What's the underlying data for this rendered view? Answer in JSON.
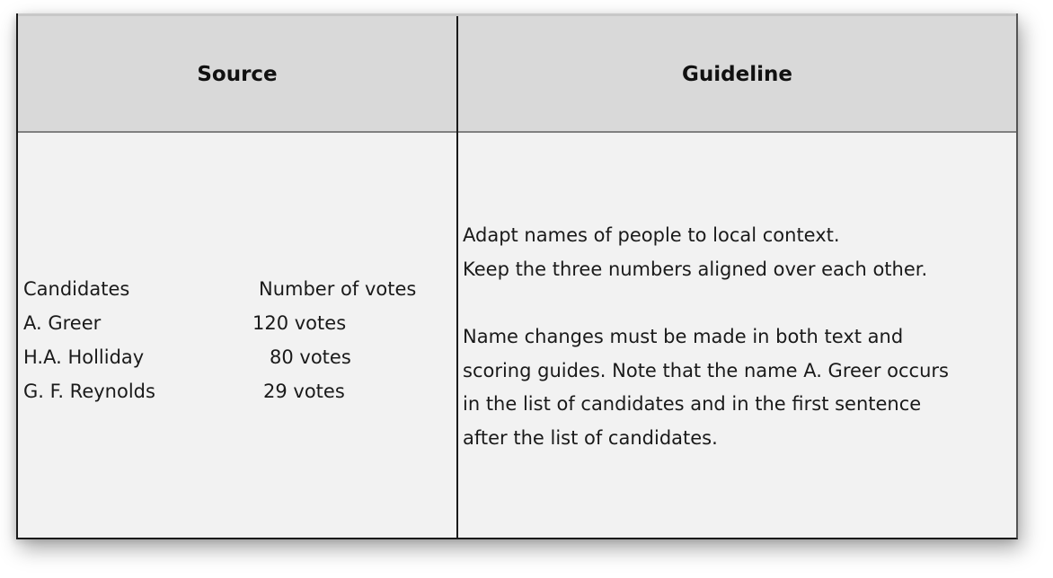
{
  "table": {
    "headers": {
      "source": "Source",
      "guideline": "Guideline"
    },
    "source": {
      "rows": [
        {
          "name": "Candidates",
          "votes": "Number of votes"
        },
        {
          "name": "A. Greer",
          "votes": "120 votes"
        },
        {
          "name": "H.A. Holliday",
          "votes": "80 votes"
        },
        {
          "name": "G. F. Reynolds",
          "votes": "29 votes"
        }
      ]
    },
    "guideline": {
      "paragraph1": [
        "Adapt names of people to local context.",
        "Keep the three numbers aligned over each other."
      ],
      "paragraph2": [
        "Name changes must be made in both text and",
        "scoring guides. Note that the name A. Greer occurs",
        "in the list of candidates and in the first sentence",
        "after the list of candidates."
      ]
    }
  }
}
